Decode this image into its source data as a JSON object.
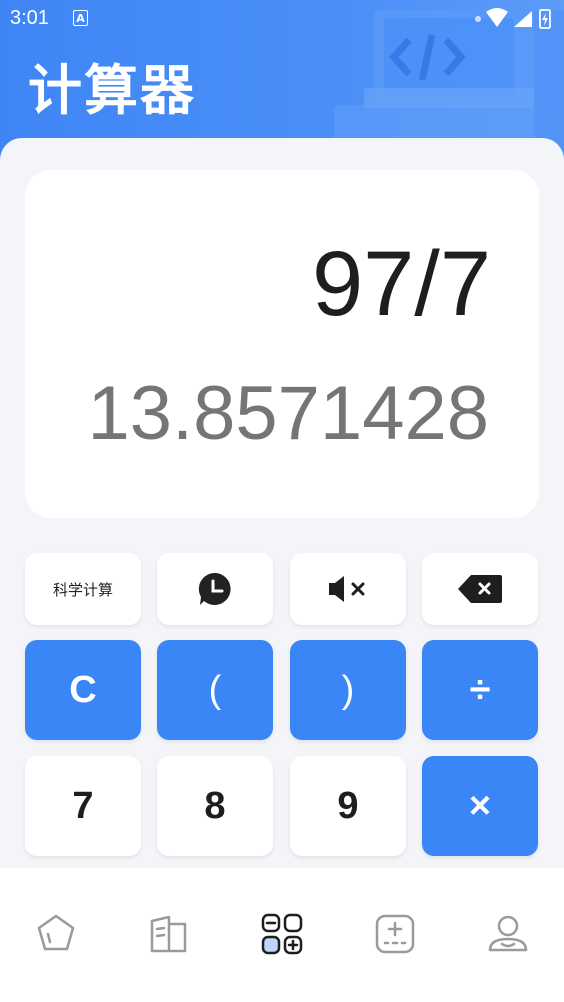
{
  "status_bar": {
    "time": "3:01",
    "notification_icon": "A"
  },
  "header": {
    "title": "计算器"
  },
  "display": {
    "expression": "97/7",
    "result": "13.8571428"
  },
  "keys": {
    "row1": [
      "科学计算",
      "history-icon",
      "mute-icon",
      "backspace-icon"
    ],
    "clear": "C",
    "open_paren": "(",
    "close_paren": ")",
    "divide": "÷",
    "seven": "7",
    "eight": "8",
    "nine": "9",
    "multiply": "×"
  },
  "tabs": [
    {
      "icon": "pentagon-icon",
      "active": false
    },
    {
      "icon": "book-icon",
      "active": false
    },
    {
      "icon": "calculator-icon",
      "active": true
    },
    {
      "icon": "plus-box-icon",
      "active": false
    },
    {
      "icon": "user-icon",
      "active": false
    }
  ],
  "colors": {
    "primary": "#3a86f6",
    "background": "#f3f5f9",
    "key_white": "#ffffff"
  }
}
